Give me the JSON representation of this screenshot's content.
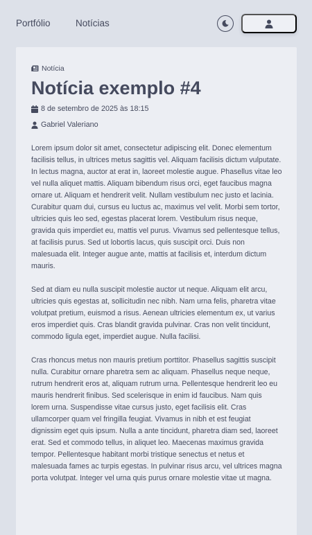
{
  "nav": {
    "links": [
      "Portfólio",
      "Notícias"
    ],
    "theme_icon": "moon-icon",
    "user_icon": "user-icon"
  },
  "article": {
    "category": "Notícia",
    "category_icon": "newspaper-icon",
    "title": "Notícia exemplo #4",
    "date": "8 de setembro de 2025 às 18:15",
    "date_icon": "calendar-icon",
    "author": "Gabriel Valeriano",
    "author_icon": "user-icon",
    "paragraphs": [
      "Lorem ipsum dolor sit amet, consectetur adipiscing elit. Donec elementum facilisis tellus, in ultrices metus sagittis vel. Aliquam facilisis dictum vulputate. In lectus magna, auctor at erat in, laoreet molestie augue. Phasellus vitae leo vel nulla aliquet mattis. Aliquam bibendum risus orci, eget faucibus magna ornare ut. Aliquam et hendrerit velit. Nullam vestibulum nec justo et lacinia. Curabitur quam dui, cursus eu luctus ac, maximus vel velit. Morbi sem tortor, ultricies quis leo sed, egestas placerat lorem. Vestibulum risus neque, gravida quis imperdiet eu, mattis vel purus. Vivamus sed pellentesque tellus, at facilisis purus. Sed ut lobortis lacus, quis suscipit orci. Duis non malesuada elit. Integer augue ante, mattis at facilisis et, interdum dictum mauris.",
      "Sed at diam eu nulla suscipit molestie auctor ut neque. Aliquam elit arcu, ultricies quis egestas at, sollicitudin nec nibh. Nam urna felis, pharetra vitae volutpat pretium, euismod a risus. Aenean ultricies elementum ex, ut varius eros imperdiet quis. Cras blandit gravida pulvinar. Cras non velit tincidunt, commodo ligula eget, imperdiet augue. Nulla facilisi.",
      "Cras rhoncus metus non mauris pretium porttitor. Phasellus sagittis suscipit nulla. Curabitur ornare pharetra sem ac aliquam. Phasellus neque neque, rutrum hendrerit eros at, aliquam rutrum urna. Pellentesque hendrerit leo eu mauris hendrerit finibus. Sed scelerisque in enim id faucibus. Nam quis lorem urna. Suspendisse vitae cursus justo, eget facilisis elit. Cras ullamcorper quam vel fringilla feugiat. Vivamus in nibh et est feugiat dignissim eget quis ipsum. Nulla a ante tincidunt, pharetra diam sed, laoreet erat. Sed et commodo tellus, in aliquet leo. Maecenas maximus gravida tempor. Pellentesque habitant morbi tristique senectus et netus et malesuada fames ac turpis egestas. In pulvinar risus arcu, vel ultrices magna porta volutpat. Integer vel urna quis purus ornare molestie vitae ut magna."
    ]
  },
  "colors": {
    "page_background": "#dde1e9",
    "card_background": "#eceef3",
    "text": "#454a5e",
    "button_background": "#eef0f5"
  }
}
